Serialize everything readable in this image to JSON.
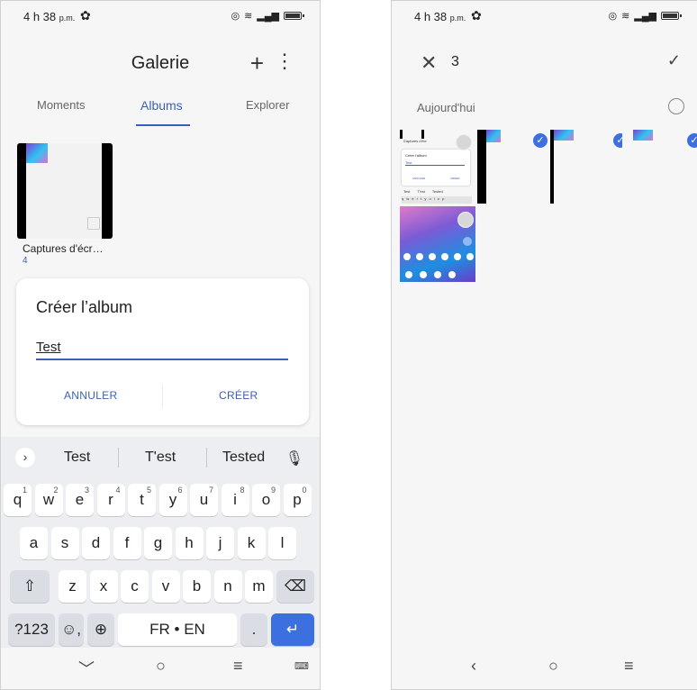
{
  "status": {
    "time": "4 h 38",
    "ampm": "p.m."
  },
  "left": {
    "title": "Galerie",
    "plus_icon": "plus-icon",
    "more_icon": "more-vertical-icon",
    "tabs": [
      {
        "label": "Moments"
      },
      {
        "label": "Albums"
      },
      {
        "label": "Explorer"
      }
    ],
    "active_tab": "Albums",
    "album": {
      "name": "Captures d'écr…",
      "count": "4"
    },
    "dialog": {
      "title": "Créer l’album",
      "input_value": "Test",
      "cancel_label": "ANNULER",
      "create_label": "CRÉER"
    },
    "keyboard": {
      "suggestions": [
        "Test",
        "T'est",
        "Tested"
      ],
      "row1": [
        {
          "k": "q",
          "n": "1"
        },
        {
          "k": "w",
          "n": "2"
        },
        {
          "k": "e",
          "n": "3"
        },
        {
          "k": "r",
          "n": "4"
        },
        {
          "k": "t",
          "n": "5"
        },
        {
          "k": "y",
          "n": "6"
        },
        {
          "k": "u",
          "n": "7"
        },
        {
          "k": "i",
          "n": "8"
        },
        {
          "k": "o",
          "n": "9"
        },
        {
          "k": "p",
          "n": "0"
        }
      ],
      "row2": [
        "a",
        "s",
        "d",
        "f",
        "g",
        "h",
        "j",
        "k",
        "l"
      ],
      "row3": [
        "z",
        "x",
        "c",
        "v",
        "b",
        "n",
        "m"
      ],
      "symbols_label": "?123",
      "space_label": "FR • EN",
      "period_label": "."
    }
  },
  "right": {
    "selected_count": "3",
    "day_label": "Aujourd'hui",
    "thumb_labels": {
      "a": "Captures d'écr",
      "b": "Créer l'album",
      "c": "Test",
      "d": "ANNULER",
      "e": "CRÉER",
      "f": "Test",
      "g": "T'est",
      "h": "Tested",
      "i": "q w e r t y u i o p"
    }
  },
  "colors": {
    "accent": "#3c5fb5",
    "enter": "#3c6fe0"
  }
}
